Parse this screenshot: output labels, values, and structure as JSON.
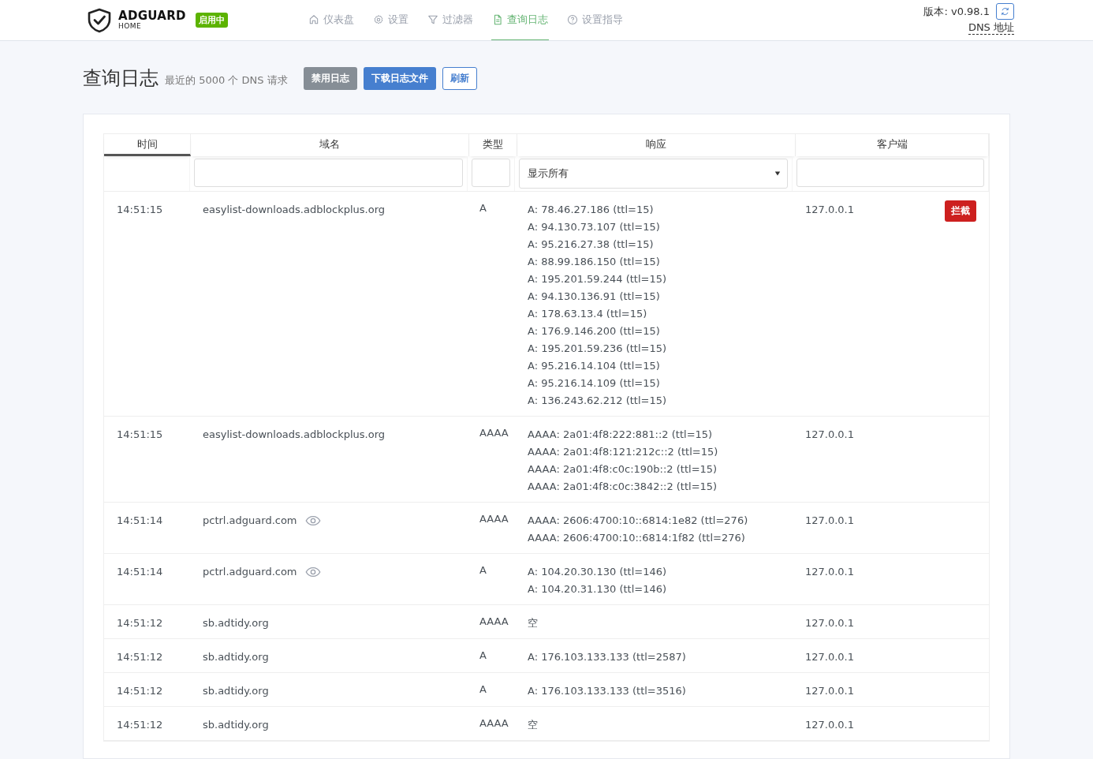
{
  "header": {
    "brand": "ADGUARD",
    "brand_sub": "HOME",
    "status_badge": "启用中",
    "nav": [
      {
        "label": "仪表盘",
        "selected": false
      },
      {
        "label": "设置",
        "selected": false
      },
      {
        "label": "过滤器",
        "selected": false
      },
      {
        "label": "查询日志",
        "selected": true
      },
      {
        "label": "设置指导",
        "selected": false
      }
    ],
    "version": "版本: v0.98.1",
    "dns_link": "DNS 地址"
  },
  "page": {
    "title": "查询日志",
    "subtitle": "最近的 5000 个 DNS 请求",
    "buttons": [
      {
        "label": "禁用日志",
        "kind": "secondary"
      },
      {
        "label": "下载日志文件",
        "kind": "primary"
      },
      {
        "label": "刷新",
        "kind": "outline"
      }
    ]
  },
  "table": {
    "columns": [
      {
        "label": "时间",
        "sorted": true
      },
      {
        "label": "域名",
        "sorted": false
      },
      {
        "label": "类型",
        "sorted": false
      },
      {
        "label": "响应",
        "sorted": false
      },
      {
        "label": "客户端",
        "sorted": false
      }
    ],
    "filters": {
      "response_select": "显示所有"
    },
    "rows": [
      {
        "time": "14:51:15",
        "domain": "easylist-downloads.adblockplus.org",
        "tracker": false,
        "type": "A",
        "response": [
          "A: 78.46.27.186 (ttl=15)",
          "A: 94.130.73.107 (ttl=15)",
          "A: 95.216.27.38 (ttl=15)",
          "A: 88.99.186.150 (ttl=15)",
          "A: 195.201.59.244 (ttl=15)",
          "A: 94.130.136.91 (ttl=15)",
          "A: 178.63.13.4 (ttl=15)",
          "A: 176.9.146.200 (ttl=15)",
          "A: 195.201.59.236 (ttl=15)",
          "A: 95.216.14.104 (ttl=15)",
          "A: 95.216.14.109 (ttl=15)",
          "A: 136.243.62.212 (ttl=15)"
        ],
        "client": "127.0.0.1",
        "action": "拦截"
      },
      {
        "time": "14:51:15",
        "domain": "easylist-downloads.adblockplus.org",
        "tracker": false,
        "type": "AAAA",
        "response": [
          "AAAA: 2a01:4f8:222:881::2 (ttl=15)",
          "AAAA: 2a01:4f8:121:212c::2 (ttl=15)",
          "AAAA: 2a01:4f8:c0c:190b::2 (ttl=15)",
          "AAAA: 2a01:4f8:c0c:3842::2 (ttl=15)"
        ],
        "client": "127.0.0.1"
      },
      {
        "time": "14:51:14",
        "domain": "pctrl.adguard.com",
        "tracker": true,
        "type": "AAAA",
        "response": [
          "AAAA: 2606:4700:10::6814:1e82 (ttl=276)",
          "AAAA: 2606:4700:10::6814:1f82 (ttl=276)"
        ],
        "client": "127.0.0.1"
      },
      {
        "time": "14:51:14",
        "domain": "pctrl.adguard.com",
        "tracker": true,
        "type": "A",
        "response": [
          "A: 104.20.30.130 (ttl=146)",
          "A: 104.20.31.130 (ttl=146)"
        ],
        "client": "127.0.0.1"
      },
      {
        "time": "14:51:12",
        "domain": "sb.adtidy.org",
        "tracker": false,
        "type": "AAAA",
        "response": [
          "空"
        ],
        "client": "127.0.0.1"
      },
      {
        "time": "14:51:12",
        "domain": "sb.adtidy.org",
        "tracker": false,
        "type": "A",
        "response": [
          "A: 176.103.133.133 (ttl=2587)"
        ],
        "client": "127.0.0.1"
      },
      {
        "time": "14:51:12",
        "domain": "sb.adtidy.org",
        "tracker": false,
        "type": "A",
        "response": [
          "A: 176.103.133.133 (ttl=3516)"
        ],
        "client": "127.0.0.1"
      },
      {
        "time": "14:51:12",
        "domain": "sb.adtidy.org",
        "tracker": false,
        "type": "AAAA",
        "response": [
          "空"
        ],
        "client": "127.0.0.1"
      }
    ]
  }
}
